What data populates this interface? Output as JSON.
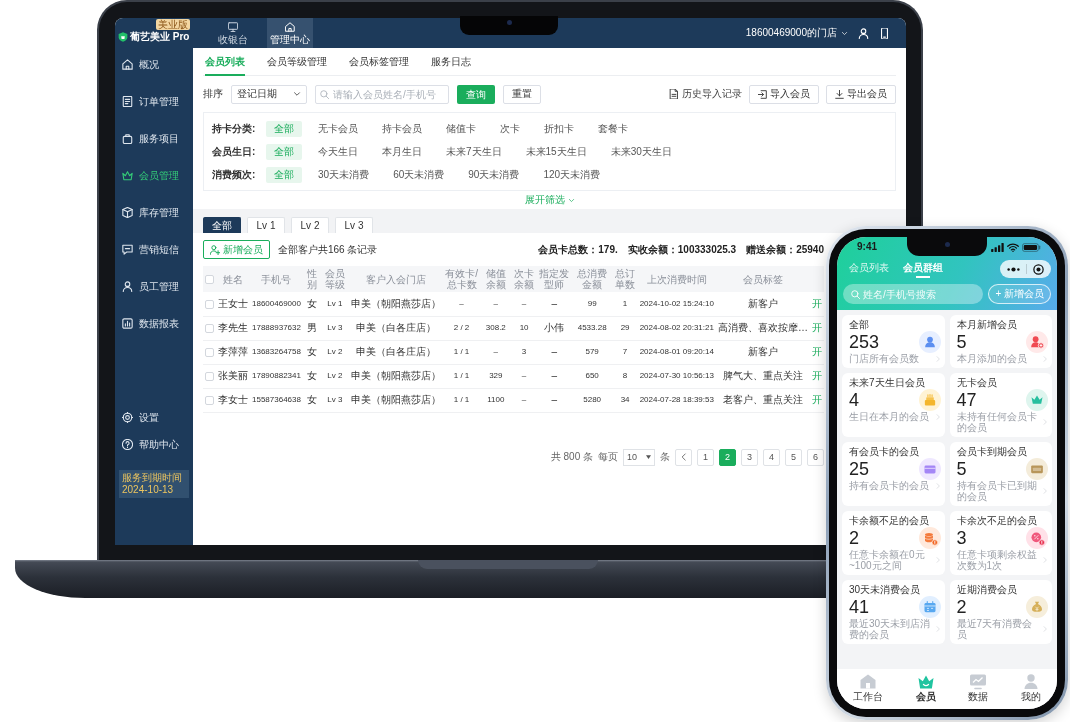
{
  "laptop": {
    "brand": {
      "name": "葡艺美业 Pro",
      "badge": "美业版"
    },
    "top_tabs": [
      {
        "label": "收银台",
        "selected": false
      },
      {
        "label": "管理中心",
        "selected": true
      }
    ],
    "store_menu": "18600469000的门店",
    "sidebar": {
      "items": [
        {
          "label": "概况",
          "selected": false
        },
        {
          "label": "订单管理",
          "selected": false
        },
        {
          "label": "服务项目",
          "selected": false
        },
        {
          "label": "会员管理",
          "selected": true
        },
        {
          "label": "库存管理",
          "selected": false
        },
        {
          "label": "营销短信",
          "selected": false
        },
        {
          "label": "员工管理",
          "selected": false
        },
        {
          "label": "数据报表",
          "selected": false
        }
      ],
      "footer_items": [
        {
          "label": "设置",
          "selected": false
        },
        {
          "label": "帮助中心",
          "selected": false
        }
      ],
      "expiry": {
        "label": "服务到期时间",
        "date": "2024-10-13"
      }
    },
    "sub_tabs": [
      {
        "label": "会员列表",
        "selected": true
      },
      {
        "label": "会员等级管理",
        "selected": false
      },
      {
        "label": "会员标签管理",
        "selected": false
      },
      {
        "label": "服务日志",
        "selected": false
      }
    ],
    "toolbar": {
      "sort_label": "排序",
      "sort_value": "登记日期",
      "search": {
        "placeholder": "请输入会员姓名/手机号"
      },
      "query_button": "查询",
      "reset_button": "重置",
      "history_link": "历史导入记录",
      "import_button": "导入会员",
      "export_button": "导出会员"
    },
    "filters": [
      {
        "label": "持卡分类:",
        "options": [
          {
            "label": "全部",
            "selected": true
          },
          {
            "label": "无卡会员",
            "selected": false
          },
          {
            "label": "持卡会员",
            "selected": false
          },
          {
            "label": "储值卡",
            "selected": false
          },
          {
            "label": "次卡",
            "selected": false
          },
          {
            "label": "折扣卡",
            "selected": false
          },
          {
            "label": "套餐卡",
            "selected": false
          }
        ]
      },
      {
        "label": "会员生日:",
        "options": [
          {
            "label": "全部",
            "selected": true
          },
          {
            "label": "今天生日",
            "selected": false
          },
          {
            "label": "本月生日",
            "selected": false
          },
          {
            "label": "未来7天生日",
            "selected": false
          },
          {
            "label": "未来15天生日",
            "selected": false
          },
          {
            "label": "未来30天生日",
            "selected": false
          }
        ]
      },
      {
        "label": "消费频次:",
        "options": [
          {
            "label": "全部",
            "selected": true
          },
          {
            "label": "30天未消费",
            "selected": false
          },
          {
            "label": "60天未消费",
            "selected": false
          },
          {
            "label": "90天未消费",
            "selected": false
          },
          {
            "label": "120天未消费",
            "selected": false
          }
        ]
      }
    ],
    "expand_link": "展开筛选",
    "level_tabs": [
      {
        "label": "全部",
        "selected": true
      },
      {
        "label": "Lv 1",
        "selected": false
      },
      {
        "label": "Lv 2",
        "selected": false
      },
      {
        "label": "Lv 3",
        "selected": false
      }
    ],
    "add_button": "新增会员",
    "record_count": "全部客户共166 条记录",
    "stats": [
      "会员卡总数：179.",
      "实收余额：100333025.3",
      "赠送余额：25940"
    ],
    "table": {
      "all_checked": false,
      "columns": [
        "姓名",
        "手机号",
        "性别",
        "会员等级",
        "客户入会门店",
        "有效卡/总卡数",
        "储值余额",
        "次卡余额",
        "指定发型师",
        "总消费金额",
        "总订单数",
        "上次消费时间",
        "会员标签"
      ],
      "rows": [
        {
          "checked": false,
          "cells": [
            "王女士",
            "18600469000",
            "女",
            "Lv 1",
            "申美（朝阳燕莎店）",
            "–",
            "–",
            "–",
            "–",
            "99",
            "1",
            "2024-10-02 15:24:10",
            "新客户"
          ],
          "action": "开"
        },
        {
          "checked": false,
          "cells": [
            "李先生",
            "17888937632",
            "男",
            "Lv 3",
            "申美（白各庄店）",
            "2 / 2",
            "308.2",
            "10",
            "小伟",
            "4533.28",
            "29",
            "2024-08-02 20:31:21",
            "高消费、喜欢按摩…"
          ],
          "action": "开"
        },
        {
          "checked": false,
          "cells": [
            "李萍萍",
            "13683264758",
            "女",
            "Lv 2",
            "申美（白各庄店）",
            "1 / 1",
            "–",
            "3",
            "–",
            "579",
            "7",
            "2024-08-01 09:20:14",
            "新客户"
          ],
          "action": "开"
        },
        {
          "checked": false,
          "cells": [
            "张美丽",
            "17890882341",
            "女",
            "Lv 2",
            "申美（朝阳燕莎店）",
            "1 / 1",
            "329",
            "–",
            "–",
            "650",
            "8",
            "2024-07-30 10:56:13",
            "脾气大、重点关注"
          ],
          "action": "开"
        },
        {
          "checked": false,
          "cells": [
            "李女士",
            "15587364638",
            "女",
            "Lv 3",
            "申美（朝阳燕莎店）",
            "1 / 1",
            "1100",
            "–",
            "–",
            "5280",
            "34",
            "2024-07-28 18:39:53",
            "老客户、重点关注"
          ],
          "action": "开"
        }
      ]
    },
    "pagination": {
      "total": "共 800 条",
      "per_page_label": "每页",
      "per_page": "10",
      "per_page_unit": "条",
      "pages": [
        {
          "label": "1",
          "selected": false
        },
        {
          "label": "2",
          "selected": true
        },
        {
          "label": "3",
          "selected": false
        },
        {
          "label": "4",
          "selected": false
        },
        {
          "label": "5",
          "selected": false
        },
        {
          "label": "6",
          "selected": false
        }
      ]
    }
  },
  "phone": {
    "time": "9:41",
    "tabs": [
      {
        "label": "会员列表",
        "selected": false
      },
      {
        "label": "会员群组",
        "selected": true
      }
    ],
    "search": {
      "placeholder": "姓名/手机号搜索"
    },
    "add_button": "+ 新增会员",
    "groups": [
      {
        "title": "全部",
        "count": "253",
        "note": "门店所有会员数"
      },
      {
        "title": "本月新增会员",
        "count": "5",
        "note": "本月添加的会员"
      },
      {
        "title": "未来7天生日会员",
        "count": "4",
        "note": "生日在本月的会员"
      },
      {
        "title": "无卡会员",
        "count": "47",
        "note": "未持有任何会员卡的会员"
      },
      {
        "title": "有会员卡的会员",
        "count": "25",
        "note": "持有会员卡的会员"
      },
      {
        "title": "会员卡到期会员",
        "count": "5",
        "note": "持有会员卡已到期的会员"
      },
      {
        "title": "卡余额不足的会员",
        "count": "2",
        "note": "任意卡余额在0元~100元之间"
      },
      {
        "title": "卡余次不足的会员",
        "count": "3",
        "note": "任意卡项剩余权益次数为1次"
      },
      {
        "title": "30天未消费会员",
        "count": "41",
        "note": "最近30天未到店消费的会员"
      },
      {
        "title": "近期消费会员",
        "count": "2",
        "note": "最近7天有消费会员"
      }
    ],
    "nav": [
      {
        "label": "工作台",
        "selected": false
      },
      {
        "label": "会员",
        "selected": true
      },
      {
        "label": "数据",
        "selected": false
      },
      {
        "label": "我的",
        "selected": false
      }
    ]
  }
}
